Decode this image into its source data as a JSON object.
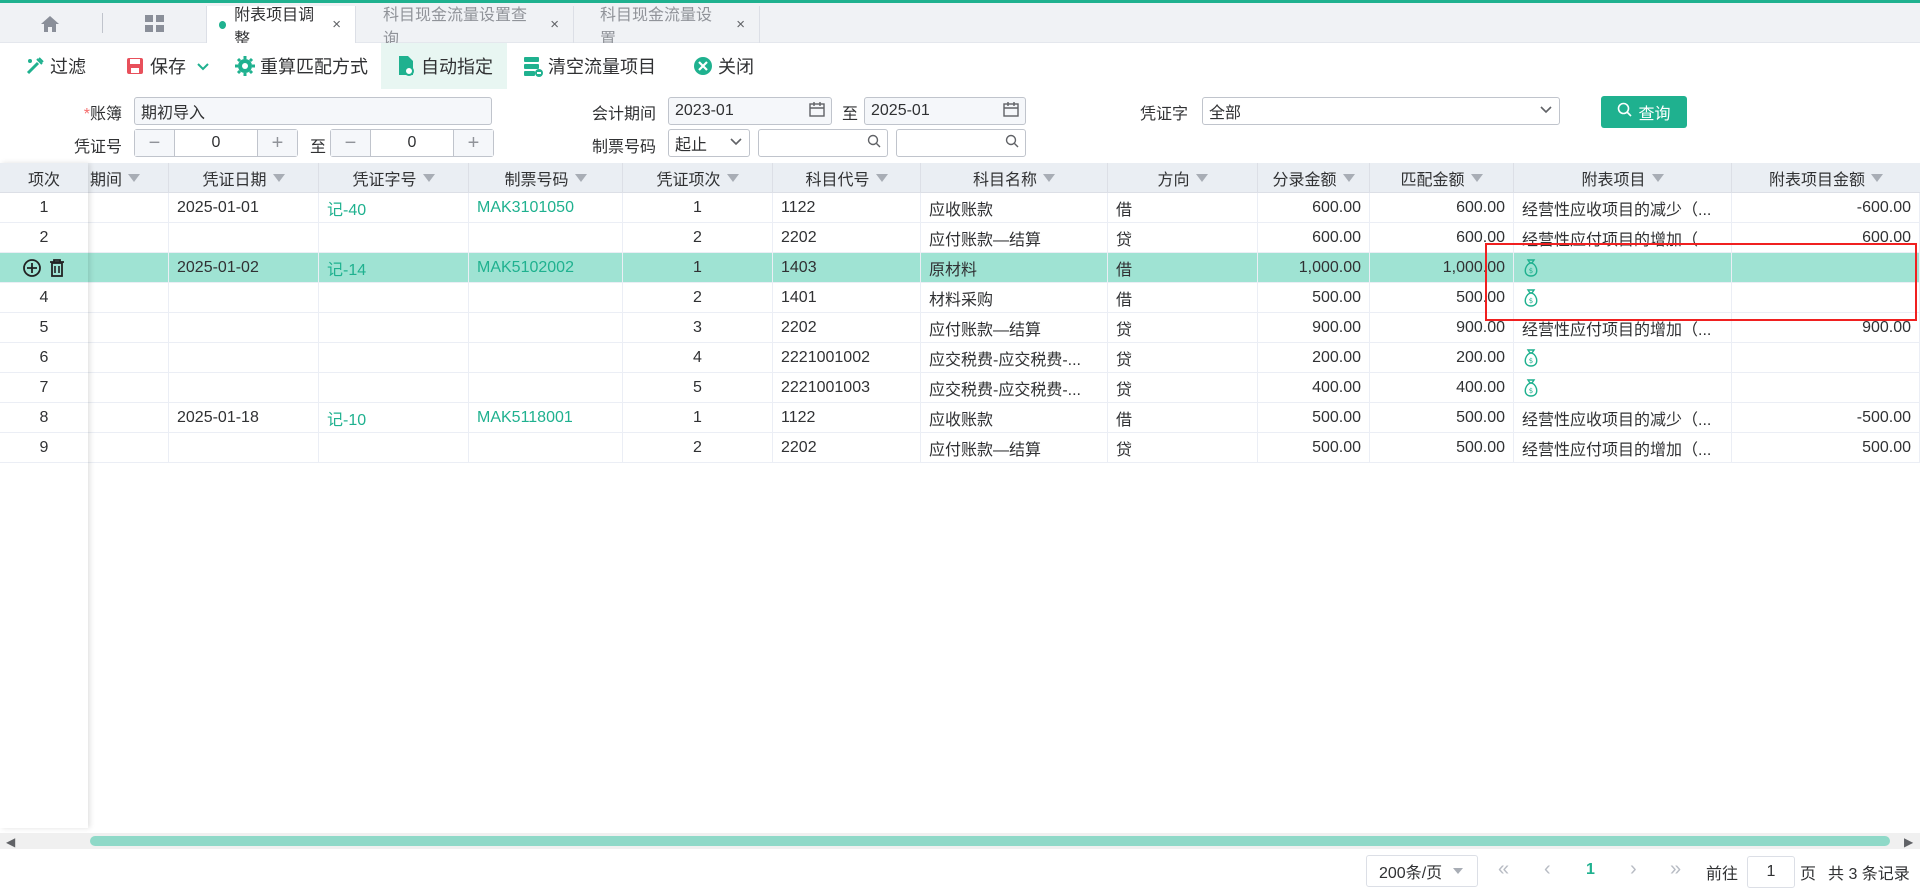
{
  "tabs": {
    "active": "附表项目调整",
    "items": [
      {
        "label": "附表项目调整"
      },
      {
        "label": "科目现金流量设置查询"
      },
      {
        "label": "科目现金流量设置"
      }
    ],
    "close": "×"
  },
  "toolbar": {
    "filter": "过滤",
    "save": "保存",
    "recalc": "重算匹配方式",
    "auto": "自动指定",
    "clear": "清空流量项目",
    "close": "关闭"
  },
  "form": {
    "ledger_label": "账簿",
    "ledger_required": "*",
    "ledger_value": "期初导入",
    "period_label": "会计期间",
    "period_from": "2023-01",
    "to": "至",
    "period_to": "2025-01",
    "voucher_word_label": "凭证字",
    "voucher_word_value": "全部",
    "voucher_no_label": "凭证号",
    "voucher_no_from": "0",
    "voucher_no_to": "0",
    "ticket_label": "制票号码",
    "ticket_mode": "起止",
    "query": "查询"
  },
  "table": {
    "headers": {
      "idx": "项次",
      "period": "期间",
      "date": "凭证日期",
      "word": "凭证字号",
      "ticket": "制票号码",
      "item": "凭证项次",
      "code": "科目代号",
      "name": "科目名称",
      "dir": "方向",
      "amount": "分录金额",
      "match": "匹配金额",
      "sched": "附表项目",
      "sched_amount": "附表项目金额"
    },
    "rows": [
      {
        "idx": "1",
        "date": "2025-01-01",
        "word": "记-40",
        "ticket": "MAK3101050",
        "item": "1",
        "code": "1122",
        "name": "应收账款",
        "dir": "借",
        "amount": "600.00",
        "match": "600.00",
        "sched": "经营性应收项目的减少（...",
        "sched_amount": "-600.00"
      },
      {
        "idx": "2",
        "date": "",
        "word": "",
        "ticket": "",
        "item": "2",
        "code": "2202",
        "name": "应付账款—结算",
        "dir": "贷",
        "amount": "600.00",
        "match": "600.00",
        "sched": "经营性应付项目的增加（...",
        "sched_amount": "600.00"
      },
      {
        "idx": "",
        "date": "2025-01-02",
        "word": "记-14",
        "ticket": "MAK5102002",
        "item": "1",
        "code": "1403",
        "name": "原材料",
        "dir": "借",
        "amount": "1,000.00",
        "match": "1,000.00",
        "sched": "",
        "sched_amount": ""
      },
      {
        "idx": "4",
        "date": "",
        "word": "",
        "ticket": "",
        "item": "2",
        "code": "1401",
        "name": "材料采购",
        "dir": "借",
        "amount": "500.00",
        "match": "500.00",
        "sched": "",
        "sched_amount": ""
      },
      {
        "idx": "5",
        "date": "",
        "word": "",
        "ticket": "",
        "item": "3",
        "code": "2202",
        "name": "应付账款—结算",
        "dir": "贷",
        "amount": "900.00",
        "match": "900.00",
        "sched": "经营性应付项目的增加（...",
        "sched_amount": "900.00"
      },
      {
        "idx": "6",
        "date": "",
        "word": "",
        "ticket": "",
        "item": "4",
        "code": "2221001002",
        "name": "应交税费-应交税费-...",
        "dir": "贷",
        "amount": "200.00",
        "match": "200.00",
        "sched": "",
        "sched_amount": ""
      },
      {
        "idx": "7",
        "date": "",
        "word": "",
        "ticket": "",
        "item": "5",
        "code": "2221001003",
        "name": "应交税费-应交税费-...",
        "dir": "贷",
        "amount": "400.00",
        "match": "400.00",
        "sched": "",
        "sched_amount": ""
      },
      {
        "idx": "8",
        "date": "2025-01-18",
        "word": "记-10",
        "ticket": "MAK5118001",
        "item": "1",
        "code": "1122",
        "name": "应收账款",
        "dir": "借",
        "amount": "500.00",
        "match": "500.00",
        "sched": "经营性应收项目的减少（...",
        "sched_amount": "-500.00"
      },
      {
        "idx": "9",
        "date": "",
        "word": "",
        "ticket": "",
        "item": "2",
        "code": "2202",
        "name": "应付账款—结算",
        "dir": "贷",
        "amount": "500.00",
        "match": "500.00",
        "sched": "经营性应付项目的增加（...",
        "sched_amount": "500.00"
      }
    ]
  },
  "pager": {
    "page_size": "200条/页",
    "current": "1",
    "goto_label": "前往",
    "goto_value": "1",
    "page_unit": "页",
    "total": "共 3 条记录"
  },
  "colors": {
    "accent": "#1fb18f",
    "selected_row": "#9fe3d3",
    "annotation": "#f02020"
  }
}
